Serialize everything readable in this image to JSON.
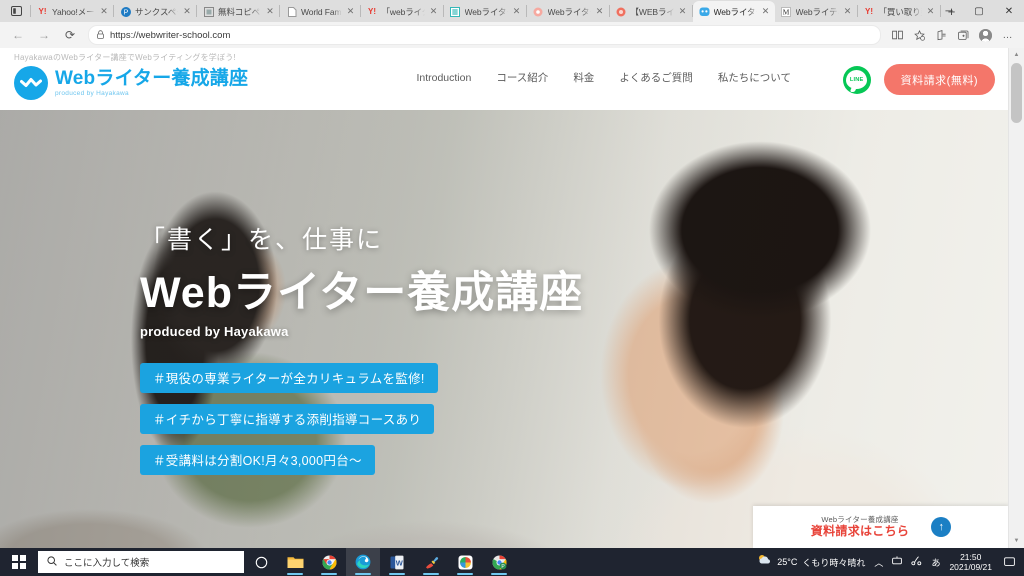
{
  "browser": {
    "tabs": [
      {
        "title": "Yahoo!メール",
        "favicon": "yahoo-icon",
        "active": false
      },
      {
        "title": "サンクスペー",
        "favicon": "p-circle-icon",
        "active": false
      },
      {
        "title": "無料コピペテ",
        "favicon": "document-icon",
        "active": false
      },
      {
        "title": "World Fam",
        "favicon": "page-icon",
        "active": false
      },
      {
        "title": "「webライター",
        "favicon": "yahoo-icon",
        "active": false
      },
      {
        "title": "Webライター",
        "favicon": "teal-list-icon",
        "active": false
      },
      {
        "title": "Webライター",
        "favicon": "pink-ring-icon",
        "active": false
      },
      {
        "title": "【WEBライタ",
        "favicon": "red-circle-icon",
        "active": false
      },
      {
        "title": "Webライター",
        "favicon": "blue-round-icon",
        "active": true
      },
      {
        "title": "Webライティ",
        "favicon": "m-letter-icon",
        "active": false
      },
      {
        "title": "「買い取り型",
        "favicon": "yahoo-icon",
        "active": false
      }
    ],
    "new_tab_label": "+",
    "close_tab_label": "✕",
    "window_controls": {
      "minimize": "─",
      "maximize": "▢",
      "close": "✕"
    },
    "nav": {
      "back": "←",
      "forward": "→",
      "reload": "⟳",
      "lock": "🔒",
      "url": "https://webwriter-school.com"
    },
    "toolbar_icons": [
      {
        "name": "read-aloud-icon",
        "glyph": "▤"
      },
      {
        "name": "add-favorite-icon",
        "glyph": "☆"
      },
      {
        "name": "favorites-icon",
        "glyph": "⛊"
      },
      {
        "name": "collections-icon",
        "glyph": "⊞"
      },
      {
        "name": "profile-avatar",
        "glyph": ""
      },
      {
        "name": "settings-more-icon",
        "glyph": "…"
      }
    ]
  },
  "site": {
    "tagline": "HayakawaのWebライター講座でWebライティングを学ぼう!",
    "logo": {
      "title": "Webライター養成講座",
      "subtitle": "produced by Hayakawa",
      "mark": "wave-circle-logo"
    },
    "nav_items": [
      {
        "label": "Introduction"
      },
      {
        "label": "コース紹介"
      },
      {
        "label": "料金"
      },
      {
        "label": "よくあるご質問"
      },
      {
        "label": "私たちについて"
      }
    ],
    "line_button": {
      "label": "LINE"
    },
    "request_button": {
      "label": "資料請求(無料)"
    },
    "hero": {
      "lead": "「書く」を、仕事に",
      "title": "Webライター養成講座",
      "byline": "produced by Hayakawa",
      "tags": [
        {
          "label": "＃現役の専業ライターが全カリキュラムを監修!"
        },
        {
          "label": "＃イチから丁寧に指導する添削指導コースあり"
        },
        {
          "label": "＃受講料は分割OK!月々3,000円台〜"
        }
      ]
    },
    "floating_cta": {
      "top_label": "Webライター養成講座",
      "main_label": "資料請求はこちら",
      "arrow": "↑"
    },
    "colors": {
      "brand_blue": "#16a7e8",
      "tag_blue": "#1ba3e0",
      "cta_coral": "#f4766a",
      "cta_red": "#e8443a",
      "line_green": "#06c755"
    }
  },
  "taskbar": {
    "start_label": "start-button",
    "search_placeholder": "ここに入力して検索",
    "apps": [
      {
        "name": "cortana-icon"
      },
      {
        "name": "file-explorer-icon"
      },
      {
        "name": "chrome-icon"
      },
      {
        "name": "edge-icon"
      },
      {
        "name": "word-icon"
      },
      {
        "name": "paint-icon"
      },
      {
        "name": "colorful-app-icon"
      },
      {
        "name": "chrome-secondary-icon"
      }
    ],
    "weather": {
      "temperature": "25°C",
      "condition": "くもり時々晴れ"
    },
    "tray_icons": [
      {
        "name": "show-hidden-icons",
        "glyph": "︿"
      },
      {
        "name": "network-icon",
        "glyph": "⌨"
      },
      {
        "name": "bluetooth-icon",
        "glyph": "∞"
      },
      {
        "name": "ime-icon",
        "glyph": "あ"
      }
    ],
    "clock": {
      "time": "21:50",
      "date": "2021/09/21"
    },
    "notifications": "▭"
  }
}
